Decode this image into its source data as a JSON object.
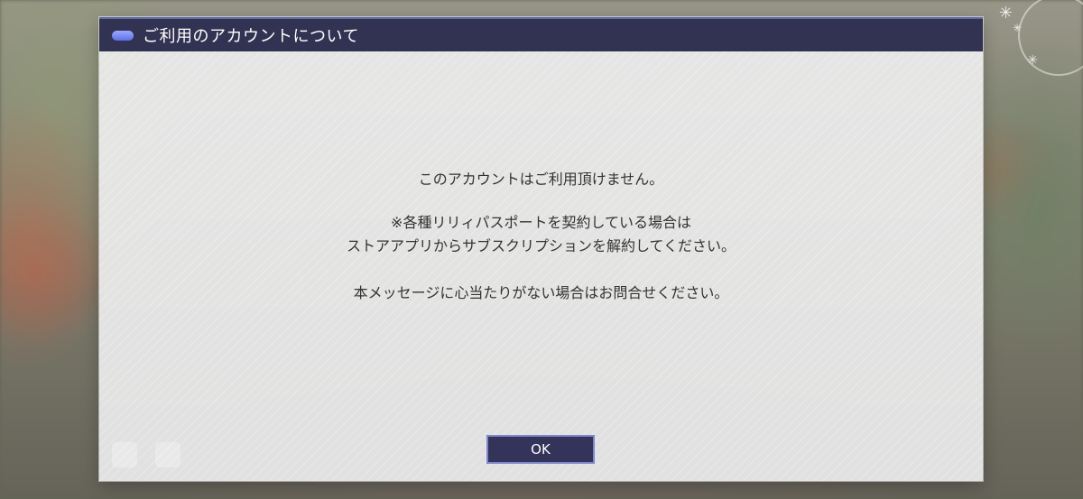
{
  "dialog": {
    "title": "ご利用のアカウントについて",
    "lines": [
      "このアカウントはご利用頂けません。",
      "※各種リリィパスポートを契約している場合は",
      "ストアアプリからサブスクリプションを解約してください。",
      "本メッセージに心当たりがない場合はお問合せください。"
    ],
    "ok_label": "OK"
  },
  "colors": {
    "header_bg": "#323252",
    "header_accent": "#5f72e6",
    "button_bg": "#34345a",
    "button_border": "#7c88c8",
    "body_text": "#333333"
  },
  "icons": {
    "header": "pill-icon",
    "sparkles": "sparkle-icon"
  }
}
